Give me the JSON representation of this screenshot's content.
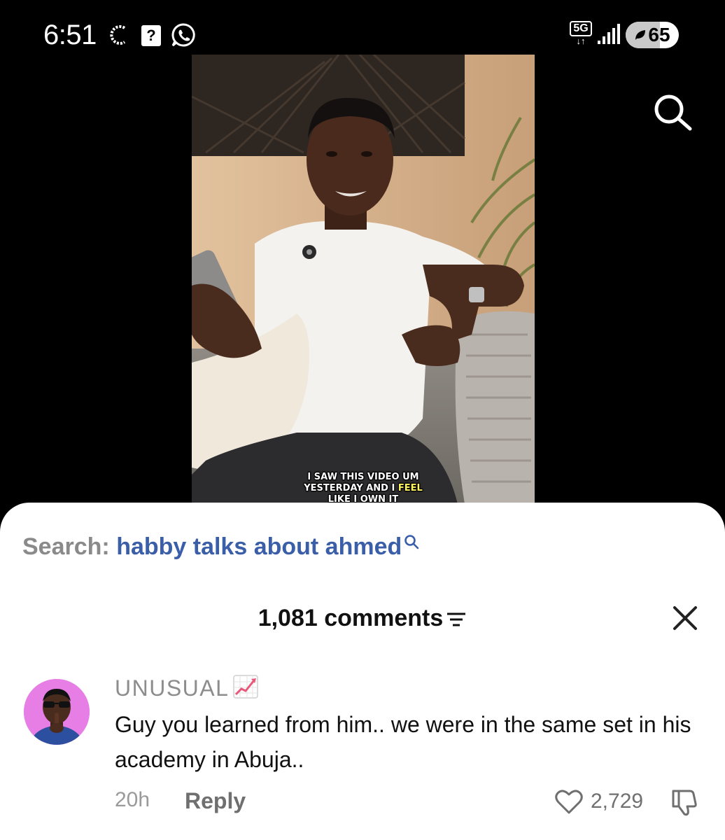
{
  "status_bar": {
    "time": "6:51",
    "network": "5G",
    "network_arrows": "↓↑",
    "battery": "65",
    "battery_level": 0.65
  },
  "video": {
    "caption_line1": "I SAW THIS VIDEO UM",
    "caption_line2_a": "YESTERDAY AND I ",
    "caption_line2_hl": "FEEL",
    "caption_line3": "LIKE I OWN IT",
    "caption_highlight_color": "#fff45c"
  },
  "search_bar": {
    "prefix": "Search:",
    "query": "habby talks about ahmed"
  },
  "comments": {
    "count_label": "1,081 comments",
    "items": [
      {
        "username": "UNUSUAL",
        "username_emoji": "chart-increasing-icon",
        "text": "Guy you learned from him.. we were in the same set in his academy in Abuja..",
        "time": "20h",
        "reply_label": "Reply",
        "likes": "2,729"
      }
    ]
  },
  "colors": {
    "search_query": "#3a5ea8",
    "avatar_bg": "#e77ee6",
    "sheet_bg": "#ffffff",
    "background": "#000000"
  }
}
